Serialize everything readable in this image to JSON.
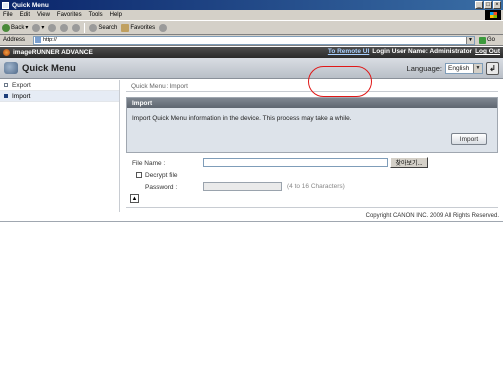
{
  "window": {
    "title": "Quick Menu"
  },
  "menubar": [
    "File",
    "Edit",
    "View",
    "Favorites",
    "Tools",
    "Help"
  ],
  "toolbar": {
    "back": "Back",
    "search": "Search",
    "favorites": "Favorites"
  },
  "address": {
    "label": "Address",
    "url": "http://",
    "go": "Go"
  },
  "app": {
    "brand": "imageRUNNER ADVANCE",
    "remote_ui": "To Remote UI",
    "login_user": "Login User Name: Administrator",
    "logout": "Log Out"
  },
  "quick_menu": {
    "title": "Quick Menu",
    "language_label": "Language:",
    "language_value": "English"
  },
  "sidebar": {
    "items": [
      {
        "label": "Export"
      },
      {
        "label": "Import"
      }
    ]
  },
  "breadcrumb": {
    "parent": "Quick Menu",
    "sep": ":",
    "current": "Import"
  },
  "panel": {
    "title": "Import",
    "description": "Import Quick Menu information in the device. This process may take a while.",
    "import_button": "Import"
  },
  "form": {
    "file_name_label": "File Name :",
    "browse_button": "찾아보기...",
    "decrypt_label": "Decrypt file",
    "password_label": "Password :",
    "password_hint": "(4 to 16 Characters)"
  },
  "footer": {
    "copyright": "Copyright CANON INC. 2009 All Rights Reserved."
  }
}
